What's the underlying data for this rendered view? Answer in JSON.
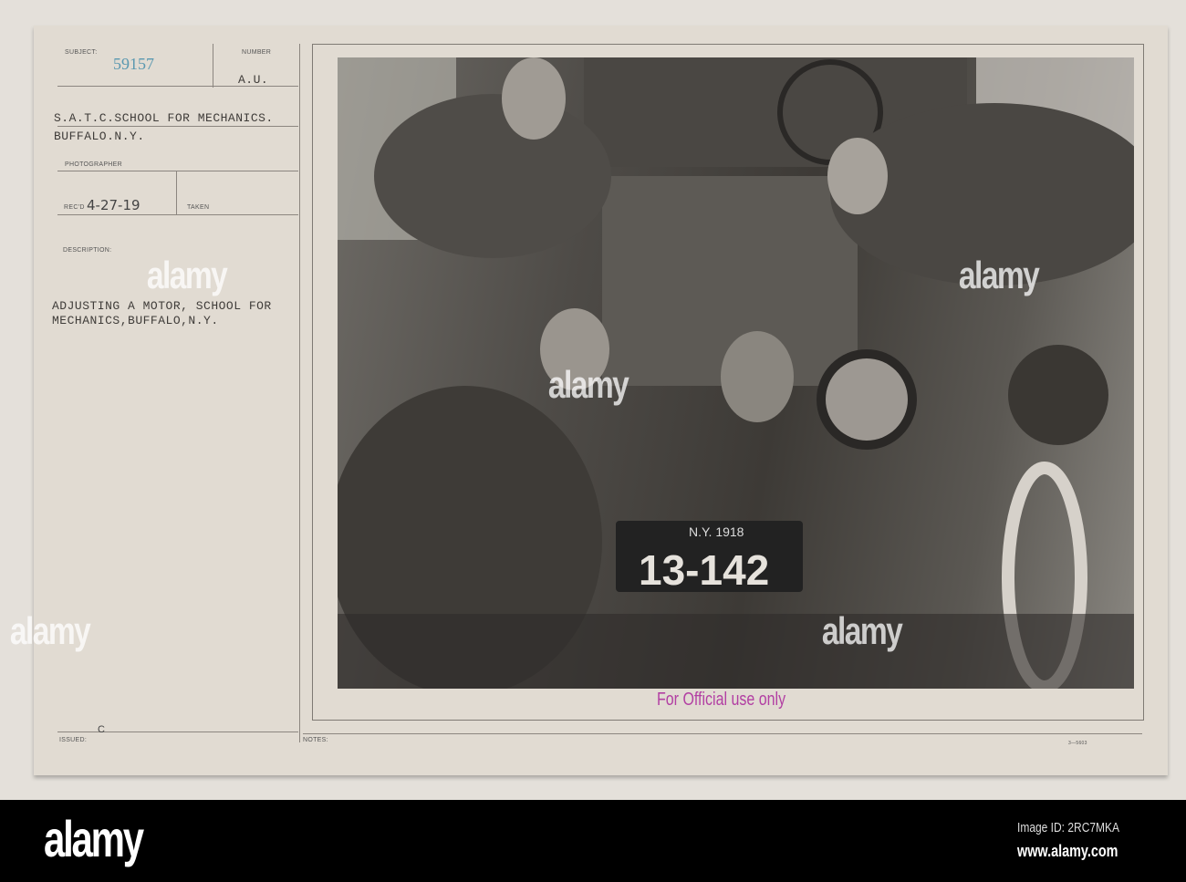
{
  "card": {
    "subject_label": "SUBJECT:",
    "subject_number": "59157",
    "number_label": "NUMBER",
    "number_value": "A.U.",
    "title_line1": "S.A.T.C.SCHOOL FOR MECHANICS.",
    "title_line2": "BUFFALO.N.Y.",
    "photographer_label": "PHOTOGRAPHER",
    "recd_label": "REC'D",
    "recd_value": "4-27-19",
    "taken_label": "TAKEN",
    "description_label": "DESCRIPTION:",
    "description_line1": "ADJUSTING A MOTOR, SCHOOL FOR",
    "description_line2": "MECHANICS,BUFFALO,N.Y.",
    "issued_label": "ISSUED:",
    "issued_value": "C",
    "notes_label": "NOTES:",
    "form_code": "3—5603",
    "stamp": "For Official use only"
  },
  "photo": {
    "plate_top": "N.Y. 1918",
    "plate_number": "13-142"
  },
  "watermark": {
    "text": "alamy",
    "image_id": "Image ID: 2RC7MKA",
    "url": "www.alamy.com"
  }
}
